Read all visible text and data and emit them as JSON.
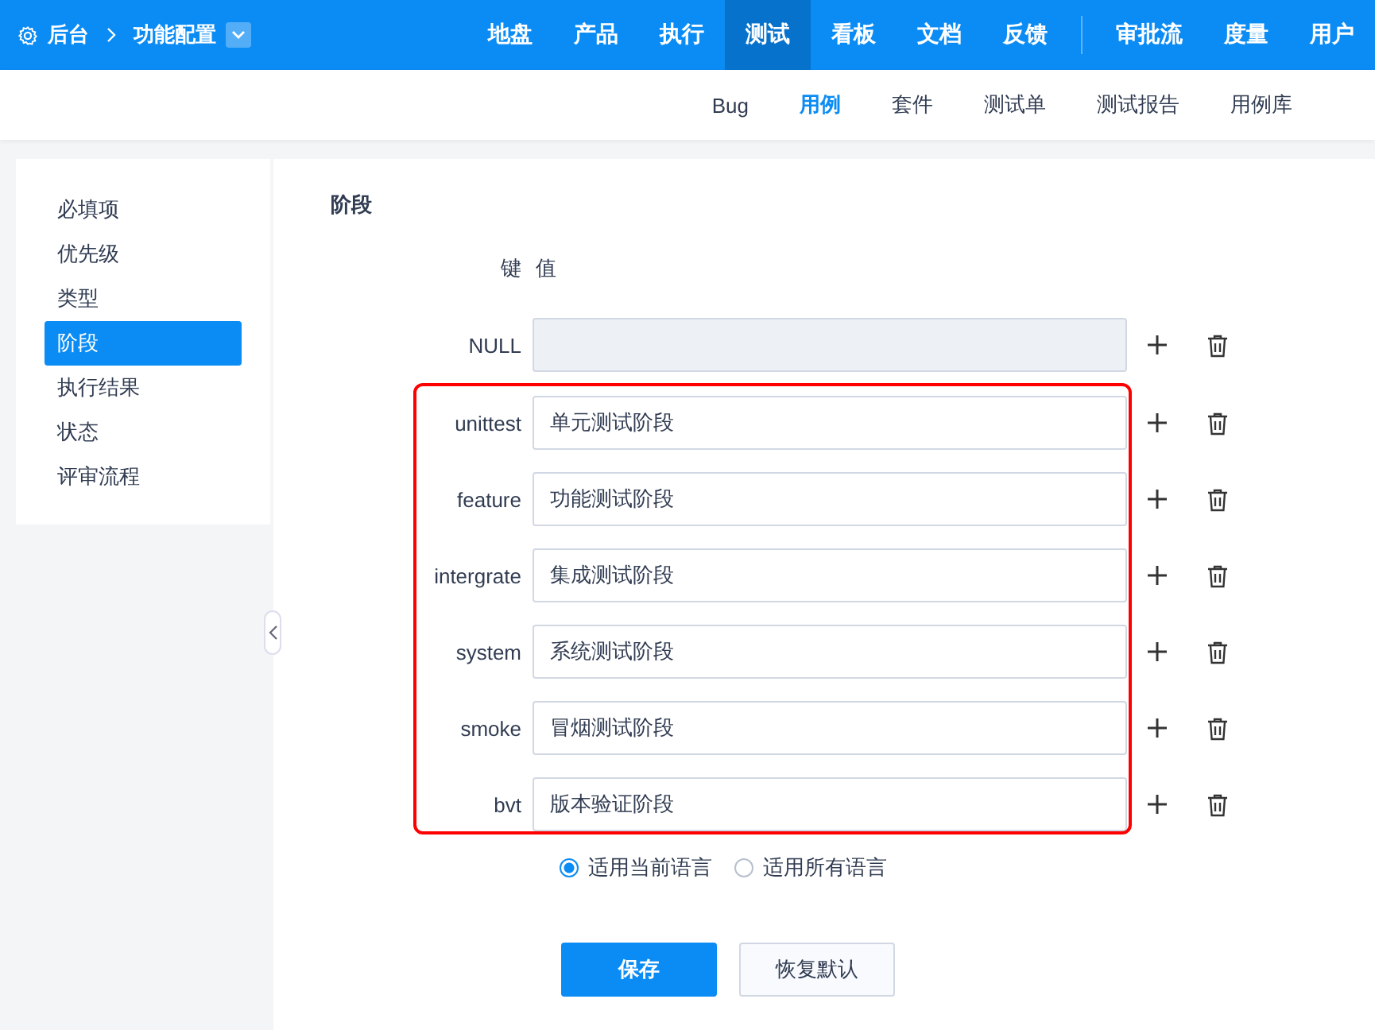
{
  "topbar": {
    "home": "后台",
    "breadcrumb": "功能配置",
    "nav": [
      {
        "label": "地盘",
        "selected": false
      },
      {
        "label": "产品",
        "selected": false
      },
      {
        "label": "执行",
        "selected": false
      },
      {
        "label": "测试",
        "selected": true
      },
      {
        "label": "看板",
        "selected": false
      },
      {
        "label": "文档",
        "selected": false
      },
      {
        "label": "反馈",
        "selected": false
      }
    ],
    "nav_right": [
      {
        "label": "审批流",
        "selected": false
      },
      {
        "label": "度量",
        "selected": false
      },
      {
        "label": "用户",
        "selected": false
      }
    ]
  },
  "subnav": [
    {
      "label": "Bug",
      "selected": false
    },
    {
      "label": "用例",
      "selected": true
    },
    {
      "label": "套件",
      "selected": false
    },
    {
      "label": "测试单",
      "selected": false
    },
    {
      "label": "测试报告",
      "selected": false
    },
    {
      "label": "用例库",
      "selected": false
    }
  ],
  "sidebar": {
    "items": [
      {
        "label": "必填项",
        "selected": false
      },
      {
        "label": "优先级",
        "selected": false
      },
      {
        "label": "类型",
        "selected": false
      },
      {
        "label": "阶段",
        "selected": true
      },
      {
        "label": "执行结果",
        "selected": false
      },
      {
        "label": "状态",
        "selected": false
      },
      {
        "label": "评审流程",
        "selected": false
      }
    ]
  },
  "form": {
    "title": "阶段",
    "key_header": "键",
    "value_header": "值",
    "rows": [
      {
        "key": "NULL",
        "disabled": true
      }
    ],
    "highlighted_rows": [
      {
        "key": "unittest",
        "value": "单元测试阶段",
        "disabled": false
      },
      {
        "key": "feature",
        "value": "功能测试阶段",
        "disabled": false
      },
      {
        "key": "intergrate",
        "value": "集成测试阶段",
        "disabled": false
      },
      {
        "key": "system",
        "value": "系统测试阶段",
        "disabled": false
      },
      {
        "key": "smoke",
        "value": "冒烟测试阶段",
        "disabled": false
      },
      {
        "key": "bvt",
        "value": "版本验证阶段",
        "disabled": false
      }
    ],
    "scope": [
      {
        "label": "适用当前语言",
        "selected": true
      },
      {
        "label": "适用所有语言",
        "selected": false
      }
    ],
    "buttons": [
      {
        "label": "保存",
        "kind": "primary"
      },
      {
        "label": "恢复默认",
        "kind": "default"
      }
    ]
  }
}
